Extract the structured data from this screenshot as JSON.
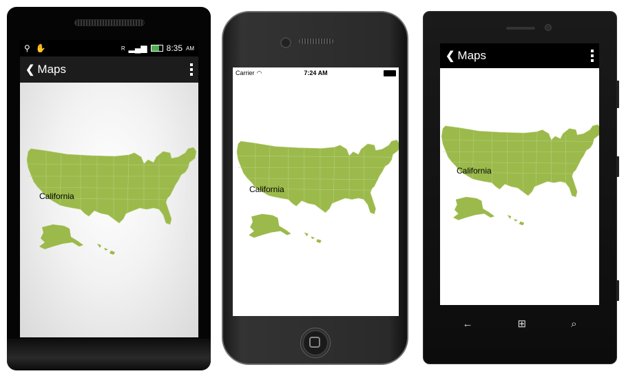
{
  "android": {
    "status_time": "8:35",
    "status_ampm": "AM",
    "network_indicator": "R",
    "app_title": "Maps",
    "map_label": "California"
  },
  "iphone": {
    "carrier": "Carrier",
    "time": "7:24 AM",
    "map_label": "California"
  },
  "windows": {
    "app_title": "Maps",
    "map_label": "California"
  },
  "icons": {
    "back": "back-chevron-icon",
    "menu": "overflow-menu-icon",
    "usb": "usb-icon",
    "battery": "battery-icon",
    "wifi": "wifi-icon",
    "win_back": "back-arrow-icon",
    "win_start": "windows-start-icon",
    "win_search": "search-icon"
  },
  "colors": {
    "map_fill": "#9bba4b",
    "android_header": "#1c1c1c",
    "wp_header": "#000000"
  }
}
